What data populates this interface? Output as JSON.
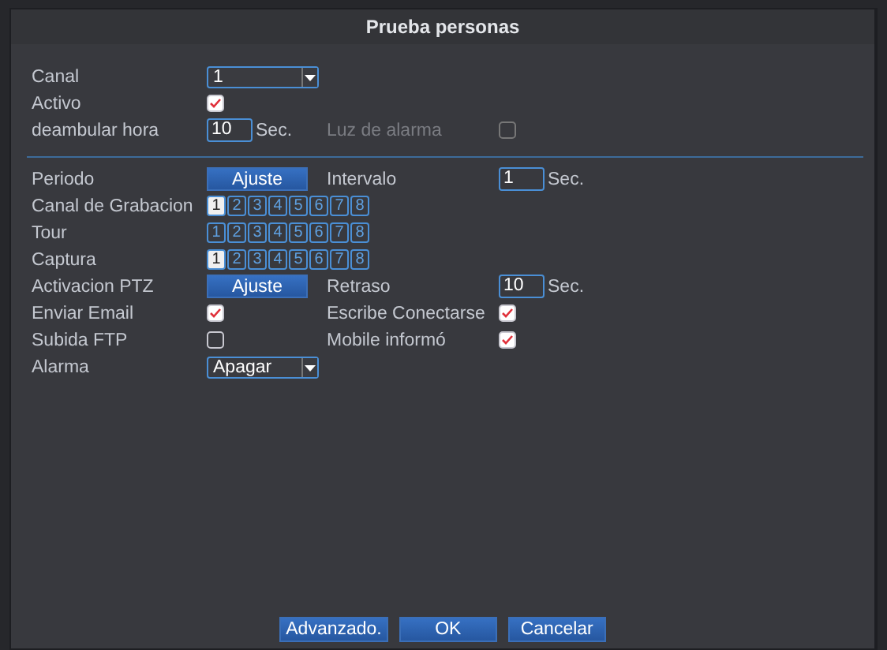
{
  "window": {
    "title": "Prueba personas"
  },
  "sections": [
    [
      {
        "items": [
          {
            "label": "Canal",
            "kind": "dropdown",
            "value": "1"
          }
        ]
      },
      {
        "items": [
          {
            "label": "Activo",
            "kind": "checkbox",
            "checked": true
          }
        ]
      },
      {
        "items": [
          {
            "label": "deambular hora",
            "kind": "number",
            "value": "10",
            "unit": "Sec."
          },
          {
            "label": "Luz de alarma",
            "kind": "checkbox",
            "checked": false,
            "disabled": true
          }
        ]
      }
    ],
    [
      {
        "items": [
          {
            "label": "Periodo",
            "kind": "button",
            "button": "Ajuste"
          },
          {
            "label": "Intervalo",
            "kind": "number",
            "value": "1",
            "unit": "Sec."
          }
        ]
      },
      {
        "items": [
          {
            "label": "Canal de Grabacion",
            "kind": "channels",
            "channels": [
              {
                "label": "1",
                "selected": true
              },
              {
                "label": "2",
                "selected": false
              },
              {
                "label": "3",
                "selected": false
              },
              {
                "label": "4",
                "selected": false
              },
              {
                "label": "5",
                "selected": false
              },
              {
                "label": "6",
                "selected": false
              },
              {
                "label": "7",
                "selected": false
              },
              {
                "label": "8",
                "selected": false
              }
            ]
          }
        ]
      },
      {
        "items": [
          {
            "label": "Tour",
            "kind": "channels",
            "channels": [
              {
                "label": "1",
                "selected": false
              },
              {
                "label": "2",
                "selected": false
              },
              {
                "label": "3",
                "selected": false
              },
              {
                "label": "4",
                "selected": false
              },
              {
                "label": "5",
                "selected": false
              },
              {
                "label": "6",
                "selected": false
              },
              {
                "label": "7",
                "selected": false
              },
              {
                "label": "8",
                "selected": false
              }
            ]
          }
        ]
      },
      {
        "items": [
          {
            "label": "Captura",
            "kind": "channels",
            "channels": [
              {
                "label": "1",
                "selected": true
              },
              {
                "label": "2",
                "selected": false
              },
              {
                "label": "3",
                "selected": false
              },
              {
                "label": "4",
                "selected": false
              },
              {
                "label": "5",
                "selected": false
              },
              {
                "label": "6",
                "selected": false
              },
              {
                "label": "7",
                "selected": false
              },
              {
                "label": "8",
                "selected": false
              }
            ]
          }
        ]
      },
      {
        "items": [
          {
            "label": "Activacion PTZ",
            "kind": "button",
            "button": "Ajuste"
          },
          {
            "label": "Retraso",
            "kind": "number",
            "value": "10",
            "unit": "Sec."
          }
        ]
      },
      {
        "items": [
          {
            "label": "Enviar Email",
            "kind": "checkbox",
            "checked": true
          },
          {
            "label": "Escribe Conectarse",
            "kind": "checkbox",
            "checked": true
          }
        ]
      },
      {
        "items": [
          {
            "label": "Subida FTP",
            "kind": "checkbox",
            "checked": false
          },
          {
            "label": "Mobile informó",
            "kind": "checkbox",
            "checked": true
          }
        ]
      },
      {
        "items": [
          {
            "label": "Alarma",
            "kind": "dropdown",
            "value": "Apagar"
          }
        ]
      }
    ]
  ],
  "buttons": [
    "Advanzado.",
    "OK",
    "Cancelar"
  ]
}
